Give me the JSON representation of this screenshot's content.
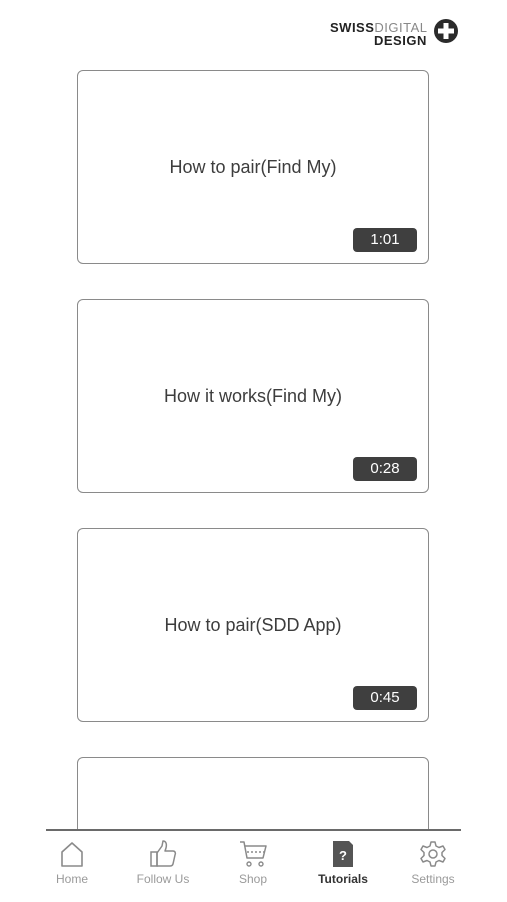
{
  "brand": {
    "part1": "SWISS",
    "part2": "DIGITAL",
    "part3": "DESIGN"
  },
  "videos": [
    {
      "title": "How to pair(Find My)",
      "duration": "1:01"
    },
    {
      "title": "How it works(Find My)",
      "duration": "0:28"
    },
    {
      "title": "How to pair(SDD App)",
      "duration": "0:45"
    },
    {
      "title": "",
      "duration": ""
    }
  ],
  "tabs": [
    {
      "label": "Home",
      "icon": "home-icon"
    },
    {
      "label": "Follow Us",
      "icon": "thumbs-up-icon"
    },
    {
      "label": "Shop",
      "icon": "cart-icon"
    },
    {
      "label": "Tutorials",
      "icon": "tutorial-doc-icon",
      "active": true
    },
    {
      "label": "Settings",
      "icon": "gear-icon"
    }
  ],
  "colors": {
    "duration_badge": "#3f3f3f",
    "active_tab": "#333333",
    "inactive_tab": "#9a9a9a"
  }
}
